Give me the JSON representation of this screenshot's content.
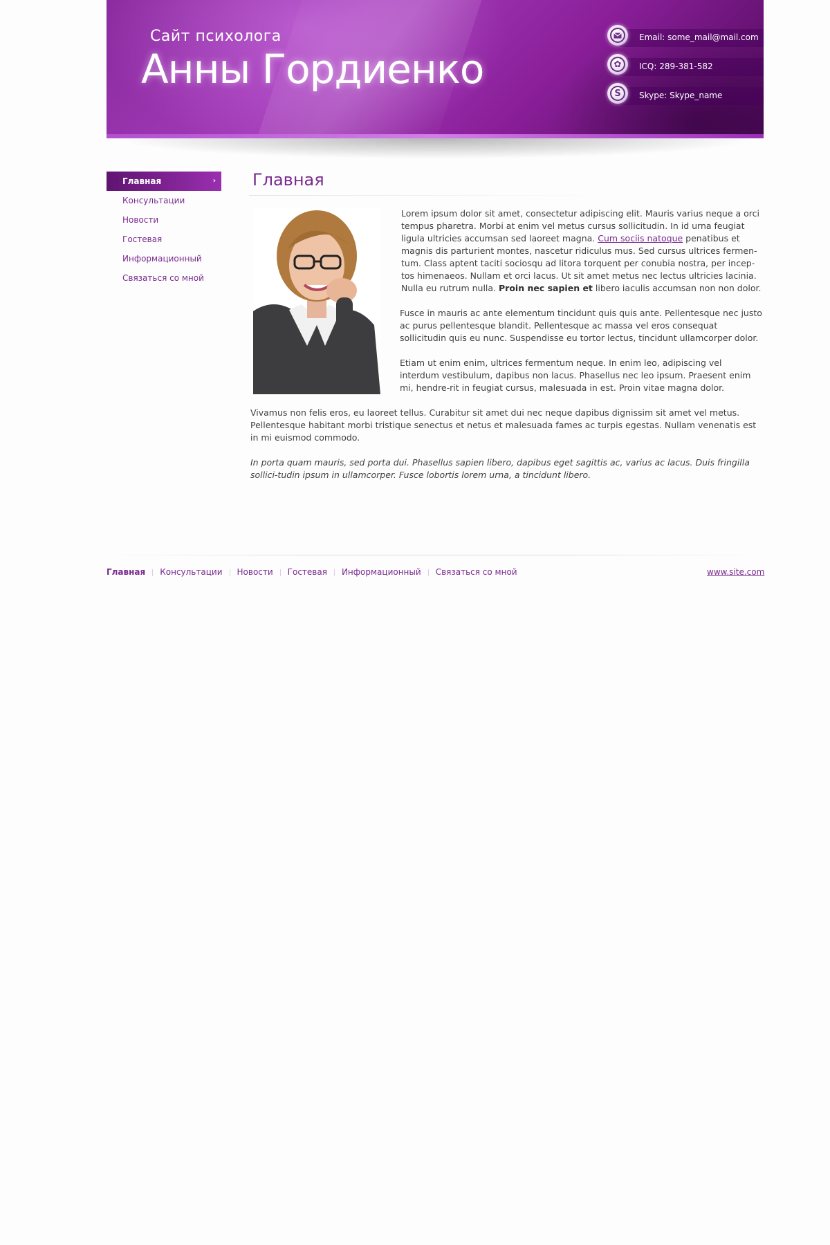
{
  "header": {
    "subtitle": "Сайт психолога",
    "title": "Анны Гордиенко",
    "contacts": [
      {
        "icon": "envelope-icon",
        "text": "Email: some_mail@mail.com"
      },
      {
        "icon": "icq-icon",
        "text": "ICQ: 289-381-582"
      },
      {
        "icon": "skype-icon",
        "text": "Skype: Skype_name"
      }
    ]
  },
  "sidebar": {
    "items": [
      {
        "label": "Главная",
        "active": true
      },
      {
        "label": "Консультации"
      },
      {
        "label": "Новости"
      },
      {
        "label": "Гостевая"
      },
      {
        "label": "Информационный"
      },
      {
        "label": "Связаться со мной"
      }
    ]
  },
  "main": {
    "title": "Главная",
    "p1_a": "Lorem ipsum dolor sit amet, consectetur adipiscing elit. Mauris varius neque a orci tempus pharetra. Morbi at enim vel metus cursus sollicitudin. In id urna feugiat ligula ultricies accumsan sed laoreet magna. ",
    "p1_link": "Cum sociis natoque",
    "p1_b": " penatibus et magnis dis parturient montes, nascetur ridiculus mus. Sed cursus ultrices fermen-tum. Class aptent taciti sociosqu ad litora torquent per conubia nostra, per incep-tos himenaeos. Nullam et orci lacus. Ut sit amet metus nec lectus ultricies lacinia. Nulla eu rutrum nulla. ",
    "p1_bold": "Proin nec sapien et",
    "p1_c": " libero iaculis accumsan non non dolor.",
    "p2": "Fusce in mauris ac ante elementum tincidunt quis quis ante. Pellentesque nec justo ac purus pellentesque blandit. Pellentesque ac massa vel eros consequat sollicitudin quis eu nunc. Suspendisse eu tortor lectus, tincidunt ullamcorper dolor.",
    "p3": "Etiam ut enim enim, ultrices fermentum neque. In enim leo, adipiscing vel interdum vestibulum, dapibus non lacus. Phasellus nec leo ipsum. Praesent enim mi, hendre-rit in feugiat cursus, malesuada in est. Proin vitae magna dolor.",
    "p4": "Vivamus non felis eros, eu laoreet tellus. Curabitur sit amet dui nec neque dapibus dignissim sit amet vel metus. Pellentesque habitant morbi tristique senectus et netus et malesuada fames ac turpis egestas. Nullam venenatis est in mi euismod commodo.",
    "p5": "In porta quam mauris, sed porta dui. Phasellus sapien libero, dapibus eget sagittis ac, varius ac lacus. Duis fringilla sollici-tudin ipsum in ullamcorper. Fusce lobortis lorem urna, a tincidunt libero."
  },
  "footer": {
    "items": [
      {
        "label": "Главная",
        "active": true
      },
      {
        "label": "Консультации"
      },
      {
        "label": "Новости"
      },
      {
        "label": "Гостевая"
      },
      {
        "label": "Информационный"
      },
      {
        "label": "Связаться со мной"
      }
    ],
    "site": "www.site.com"
  },
  "colors": {
    "accent": "#7a2a8e",
    "header": "#8b1f9a",
    "active_nav": "#5f1470"
  }
}
